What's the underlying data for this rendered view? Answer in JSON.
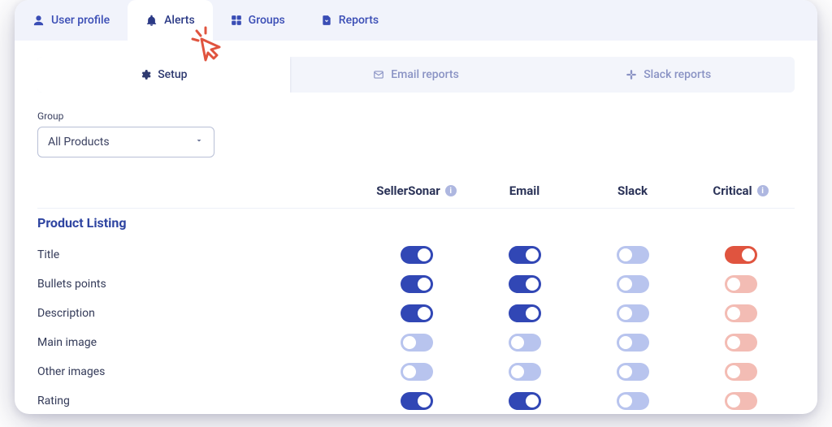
{
  "topnav": {
    "tabs": [
      {
        "label": "User profile"
      },
      {
        "label": "Alerts"
      },
      {
        "label": "Groups"
      },
      {
        "label": "Reports"
      }
    ]
  },
  "subtabs": {
    "setup": "Setup",
    "email": "Email reports",
    "slack": "Slack reports"
  },
  "group": {
    "label": "Group",
    "value": "All Products"
  },
  "columns": {
    "c0": "",
    "c1": "SellerSonar",
    "c2": "Email",
    "c3": "Slack",
    "c4": "Critical"
  },
  "section": {
    "title": "Product Listing"
  },
  "rows": [
    {
      "label": "Title",
      "sellersonar": true,
      "email": true,
      "slack": false,
      "critical": true
    },
    {
      "label": "Bullets points",
      "sellersonar": true,
      "email": true,
      "slack": false,
      "critical": false
    },
    {
      "label": "Description",
      "sellersonar": true,
      "email": true,
      "slack": false,
      "critical": false
    },
    {
      "label": "Main image",
      "sellersonar": false,
      "email": false,
      "slack": false,
      "critical": false
    },
    {
      "label": "Other images",
      "sellersonar": false,
      "email": false,
      "slack": false,
      "critical": false
    },
    {
      "label": "Rating",
      "sellersonar": true,
      "email": true,
      "slack": false,
      "critical": false
    }
  ]
}
